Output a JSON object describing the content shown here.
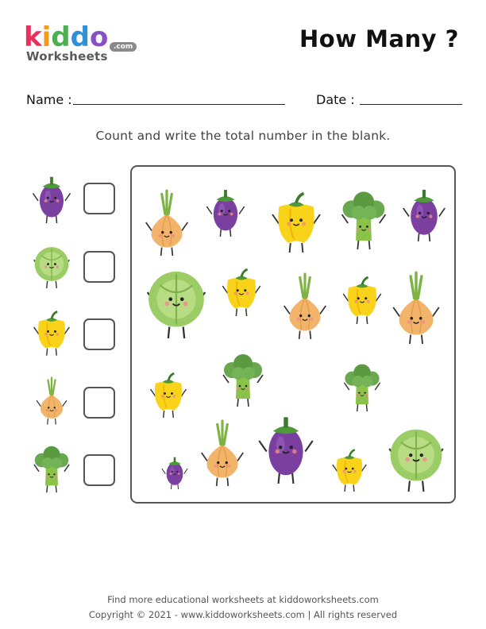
{
  "header": {
    "logo_letters": [
      "k",
      "i",
      "d",
      "d",
      "o"
    ],
    "logo_colors": [
      "#e8305b",
      "#f39a1f",
      "#4caf50",
      "#2f8fd8",
      "#8a4fc5"
    ],
    "logo_sub": "Worksheets",
    "logo_badge": ".com",
    "title": "How Many ?"
  },
  "fields": {
    "name_label": "Name :",
    "date_label": "Date :"
  },
  "instruction": "Count and write the total number in the blank.",
  "legend_items": [
    {
      "icon": "eggplant-icon",
      "answer": ""
    },
    {
      "icon": "cabbage-icon",
      "answer": ""
    },
    {
      "icon": "bell-pepper-icon",
      "answer": ""
    },
    {
      "icon": "onion-icon",
      "answer": ""
    },
    {
      "icon": "broccoli-icon",
      "answer": ""
    }
  ],
  "colors": {
    "eggplant": "#7b3fa0",
    "cabbage": "#9ccc65",
    "pepper": "#f9d21a",
    "onion": "#f2b46a",
    "broccoli": "#6aa84f",
    "border": "#555555"
  },
  "footer": {
    "line1": "Find more educational worksheets at kiddoworksheets.com",
    "line2": "Copyright © 2021 - www.kiddoworksheets.com  |  All rights reserved"
  }
}
